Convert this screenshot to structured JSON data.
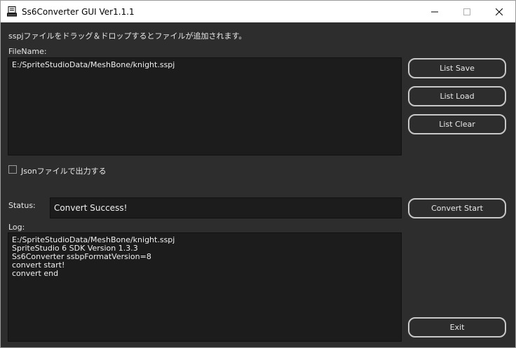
{
  "window": {
    "title": "Ss6Converter GUI Ver1.1.1"
  },
  "main": {
    "instruction": "sspjファイルをドラッグ＆ドロップするとファイルが追加されます。",
    "filename_label": "FileName:",
    "file_list": [
      "E:/SpriteStudioData/MeshBone/knight.sspj"
    ],
    "json_checkbox_label": "Jsonファイルで出力する",
    "json_checked": false,
    "status_label": "Status:",
    "status_value": "Convert Success!",
    "log_label": "Log:",
    "log_lines": [
      "E:/SpriteStudioData/MeshBone/knight.sspj",
      "SpriteStudio 6 SDK Version 1.3.3",
      "Ss6Converter ssbpFormatVersion=8",
      "convert start!",
      "convert end"
    ]
  },
  "buttons": {
    "list_save": "List Save",
    "list_load": "List Load",
    "list_clear": "List Clear",
    "convert_start": "Convert Start",
    "exit": "Exit"
  },
  "icons": {
    "app": "converter-app-icon",
    "minimize": "minimize-icon",
    "maximize": "maximize-icon",
    "close": "close-icon"
  },
  "colors": {
    "background": "#2d2d2d",
    "panel": "#1c1c1c",
    "text": "#e8e8e8",
    "button_border": "#c8c8c8"
  }
}
